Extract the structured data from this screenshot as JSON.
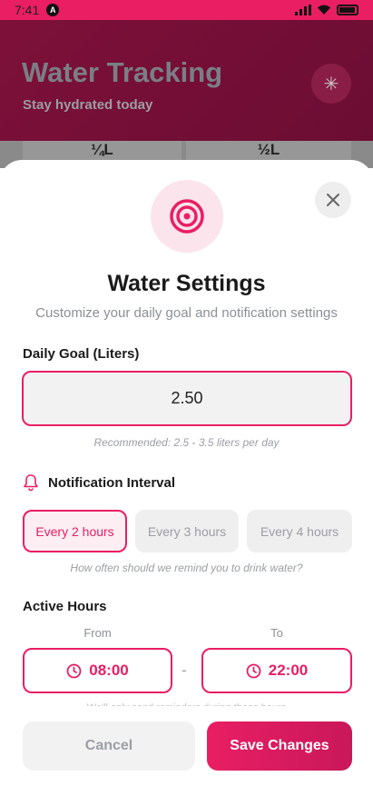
{
  "status_bar": {
    "time": "7:41"
  },
  "background_screen": {
    "title": "Water Tracking",
    "subtitle": "Stay hydrated today",
    "amounts": [
      "¼L",
      "½L"
    ]
  },
  "modal": {
    "title": "Water Settings",
    "subtitle": "Customize your daily goal and notification settings",
    "daily_goal": {
      "label": "Daily Goal (Liters)",
      "value": "2.50",
      "hint": "Recommended: 2.5 - 3.5 liters per day"
    },
    "notification": {
      "label": "Notification Interval",
      "options": [
        "Every 2 hours",
        "Every 3 hours",
        "Every 4 hours"
      ],
      "selected": "Every 2 hours",
      "hint": "How often should we remind you to drink water?"
    },
    "active_hours": {
      "label": "Active Hours",
      "from_label": "From",
      "to_label": "To",
      "from_value": "08:00",
      "to_value": "22:00",
      "separator": "-",
      "partial_hint": "We'll only send reminders during these hours"
    },
    "buttons": {
      "cancel": "Cancel",
      "save": "Save Changes"
    }
  },
  "colors": {
    "accent": "#e91e63",
    "header_bg": "#7d1039"
  }
}
